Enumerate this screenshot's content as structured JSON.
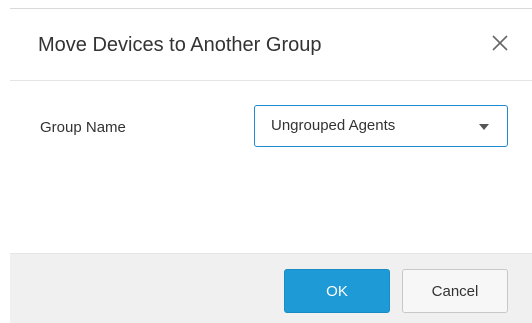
{
  "dialog": {
    "title": "Move Devices to Another Group",
    "close_icon": "close-icon"
  },
  "form": {
    "group_name_label": "Group Name",
    "group_name_value": "Ungrouped Agents",
    "dropdown_icon": "chevron-down-icon"
  },
  "footer": {
    "ok_label": "OK",
    "cancel_label": "Cancel"
  },
  "colors": {
    "primary": "#1e9ad6",
    "select_border": "#1f8ad3",
    "footer_bg": "#f0f0f0"
  }
}
